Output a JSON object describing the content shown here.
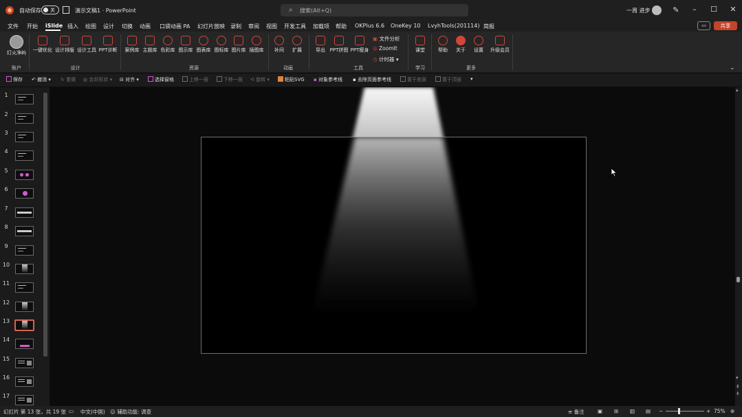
{
  "titlebar": {
    "autosave_label": "自动保存",
    "autosave_state": "关",
    "document_title": "演示文稿1 · PowerPoint",
    "search_placeholder": "搜索(Alt+Q)",
    "user_name": "一周 进步"
  },
  "menu": {
    "items": [
      "文件",
      "开始",
      "iSlide",
      "插入",
      "绘图",
      "设计",
      "切换",
      "动画",
      "口袋动画 PA",
      "幻灯片放映",
      "录制",
      "审阅",
      "视图",
      "开发工具",
      "加载项",
      "帮助",
      "OKPlus 6.6",
      "OneKey 10",
      "LvyhTools(201114)",
      "简报"
    ],
    "active": "iSlide",
    "share_label": "共享"
  },
  "ribbon": {
    "account": {
      "label": "灯火净屿",
      "group": "账户"
    },
    "design": {
      "buttons": [
        "一键优化",
        "设计排版",
        "设计工具",
        "PPT诊断"
      ],
      "group": "设计"
    },
    "resources": {
      "buttons": [
        "案例库",
        "主题库",
        "色彩库",
        "图示库",
        "图表库",
        "图标库",
        "图片库",
        "插图库"
      ],
      "group": "资源"
    },
    "animation": {
      "buttons": [
        "补间",
        "扩展"
      ],
      "group": "动画"
    },
    "tools": {
      "buttons": [
        "导出",
        "PPT拼图",
        "PPT瘦身"
      ],
      "small": [
        "文件分析",
        "ZoomIt",
        "计时器"
      ],
      "group": "工具"
    },
    "learn": {
      "buttons": [
        "课堂"
      ],
      "group": "学习"
    },
    "more": {
      "buttons": [
        "帮助",
        "关于",
        "设置",
        "升级会员"
      ],
      "group": "更多"
    }
  },
  "qat": {
    "items": [
      {
        "label": "保存",
        "enabled": true
      },
      {
        "label": "撤消",
        "enabled": true
      },
      {
        "label": "重做",
        "enabled": false
      },
      {
        "label": "合并形状",
        "enabled": false
      },
      {
        "label": "对齐",
        "enabled": true
      },
      {
        "label": "选择窗格",
        "enabled": true
      },
      {
        "label": "上移一层",
        "enabled": false
      },
      {
        "label": "下移一层",
        "enabled": false
      },
      {
        "label": "旋转",
        "enabled": false
      },
      {
        "label": "粘贴SVG",
        "enabled": true
      },
      {
        "label": "对象参考线",
        "enabled": true
      },
      {
        "label": "去除页面参考线",
        "enabled": true
      },
      {
        "label": "置于底层",
        "enabled": false
      },
      {
        "label": "置于顶层",
        "enabled": false
      }
    ]
  },
  "slides": {
    "numbers": [
      "1",
      "2",
      "3",
      "4",
      "5",
      "6",
      "7",
      "8",
      "9",
      "10",
      "11",
      "12",
      "13",
      "14",
      "15",
      "16",
      "17"
    ],
    "selected": 13
  },
  "statusbar": {
    "slide_info": "幻灯片 第 13 张，共 19 张",
    "language": "中文(中国)",
    "accessibility": "辅助功能: 调查",
    "notes": "备注",
    "zoom": "75%"
  },
  "colors": {
    "accent": "#c4432b",
    "ribbon_icon": "#d0473a",
    "selected_thumb": "#d8644f",
    "thumb_pink": "#d35ad3"
  }
}
